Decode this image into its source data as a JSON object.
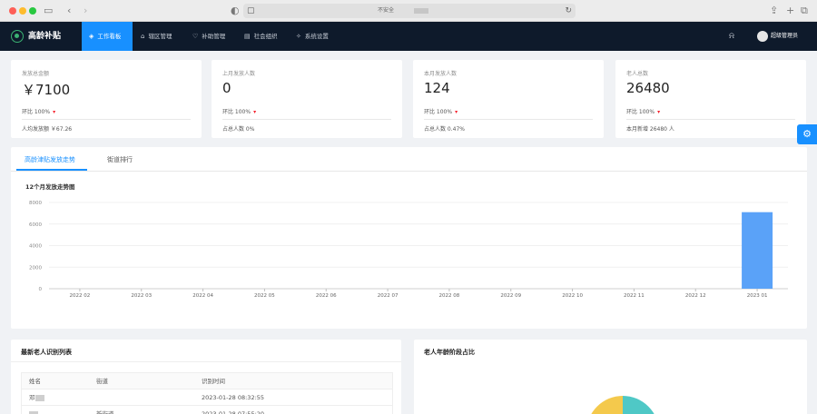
{
  "browser": {
    "address_text": "不安全",
    "icons": [
      "sidebar-icon",
      "back-icon",
      "forward-icon",
      "lock-icon",
      "reload-icon",
      "share-icon",
      "new-tab-icon",
      "tabs-icon"
    ]
  },
  "app": {
    "title": "高龄补贴",
    "nav": [
      {
        "label": "工作看板",
        "icon": "dashboard-icon",
        "active": true
      },
      {
        "label": "辖区管理",
        "icon": "home-icon"
      },
      {
        "label": "补助管理",
        "icon": "shield-icon"
      },
      {
        "label": "社会组织",
        "icon": "building-icon"
      },
      {
        "label": "系统设置",
        "icon": "settings-icon"
      }
    ],
    "user": "超级管理员"
  },
  "stats": [
    {
      "title": "发放总金额",
      "value": "￥7100",
      "trend": "环比 100%",
      "foot": "人均发放额 ￥67.26"
    },
    {
      "title": "上月发放人数",
      "value": "0",
      "trend": "环比 100%",
      "foot": "占总人数 0%"
    },
    {
      "title": "本月发放人数",
      "value": "124",
      "trend": "环比 100%",
      "foot": "占总人数 0.47%"
    },
    {
      "title": "老人总数",
      "value": "26480",
      "trend": "环比 100%",
      "foot": "本月新增 26480 人"
    }
  ],
  "colors": {
    "accent": "#1890ff",
    "nav_bg": "#0e1a2b",
    "bar": "#5aa2f8",
    "pie_yellow": "#f4c94c",
    "pie_teal": "#4fc8c6"
  },
  "tabs": [
    "高龄津贴发放走势",
    "街道排行"
  ],
  "chart_title": "12个月发放走势图",
  "chart_data": {
    "type": "bar",
    "categories": [
      "2022 02",
      "2022 03",
      "2022 04",
      "2022 05",
      "2022 06",
      "2022 07",
      "2022 08",
      "2022 09",
      "2022 10",
      "2022 11",
      "2022 12",
      "2023 01"
    ],
    "values": [
      0,
      0,
      0,
      0,
      0,
      0,
      0,
      0,
      0,
      0,
      0,
      7100
    ],
    "yticks": [
      0,
      2000,
      4000,
      6000,
      8000
    ],
    "ylim": [
      0,
      8000
    ],
    "title": "12个月发放走势图",
    "xlabel": "",
    "ylabel": "",
    "grid": true
  },
  "list": {
    "title": "最新老人识别列表",
    "columns": [
      "姓名",
      "街道",
      "识别时间"
    ],
    "rows": [
      {
        "name": "邓",
        "street": "",
        "time": "2023-01-28 08:32:55"
      },
      {
        "name": "",
        "street": "新街道",
        "time": "2023-01-28 07:55:20"
      }
    ]
  },
  "pie": {
    "title": "老人年龄阶段占比"
  }
}
